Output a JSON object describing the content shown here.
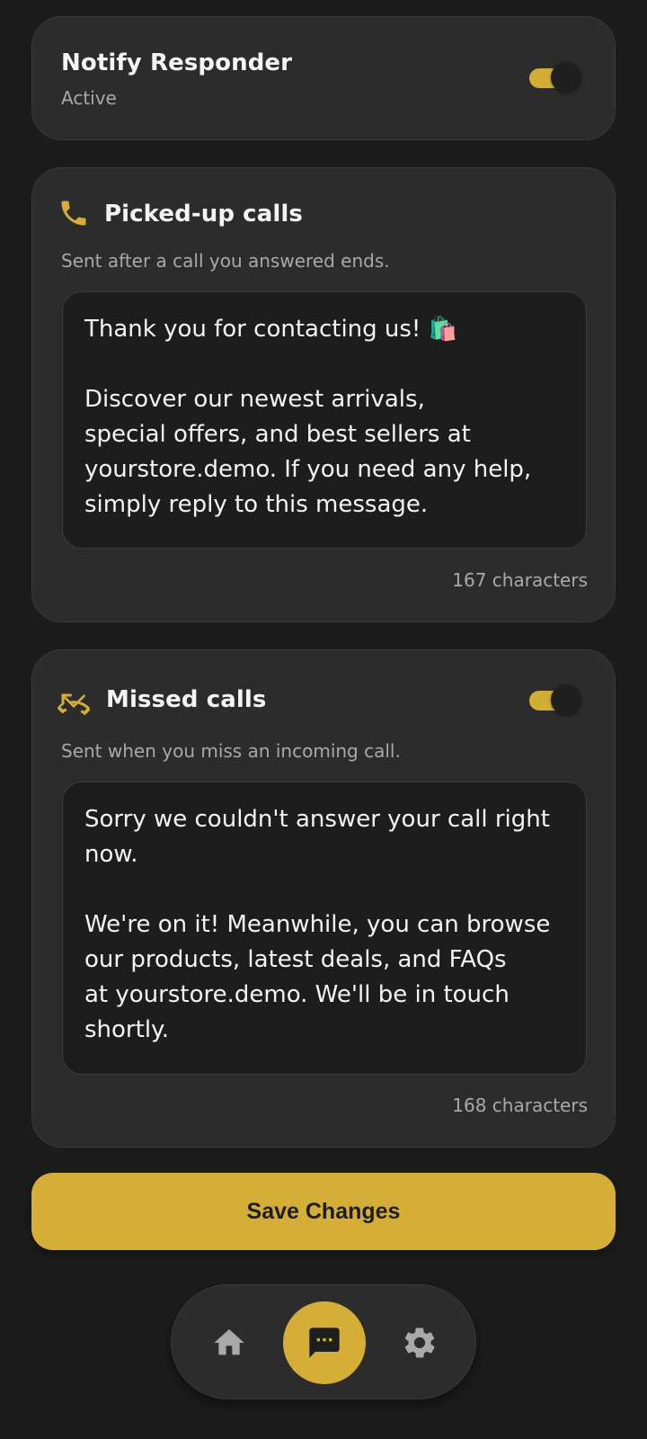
{
  "notify": {
    "title": "Notify Responder",
    "status": "Active",
    "enabled": true
  },
  "picked_up": {
    "icon": "phone-icon",
    "title": "Picked-up calls",
    "description": "Sent after a call you answered ends.",
    "message": "Thank you for contacting us! 🛍️\n\nDiscover our newest arrivals,\nspecial offers, and best sellers at\nyourstore.demo. If you need any help,\nsimply reply to this message.",
    "count": "167 characters"
  },
  "missed": {
    "icon": "missed-call-icon",
    "title": "Missed calls",
    "description": "Sent when you miss an incoming call.",
    "enabled": true,
    "message": "Sorry we couldn't answer your call right\nnow.\n\nWe're on it! Meanwhile, you can browse\nour products, latest deals, and FAQs\nat yourstore.demo. We'll be in touch\nshortly.",
    "count": "168 characters"
  },
  "save_label": "Save Changes",
  "nav": {
    "items": [
      "home-icon",
      "chat-icon",
      "gear-icon"
    ],
    "active": "chat-icon"
  },
  "colors": {
    "accent": "#d4ae37",
    "background": "#1c1c1c",
    "card": "#2c2c2c"
  }
}
